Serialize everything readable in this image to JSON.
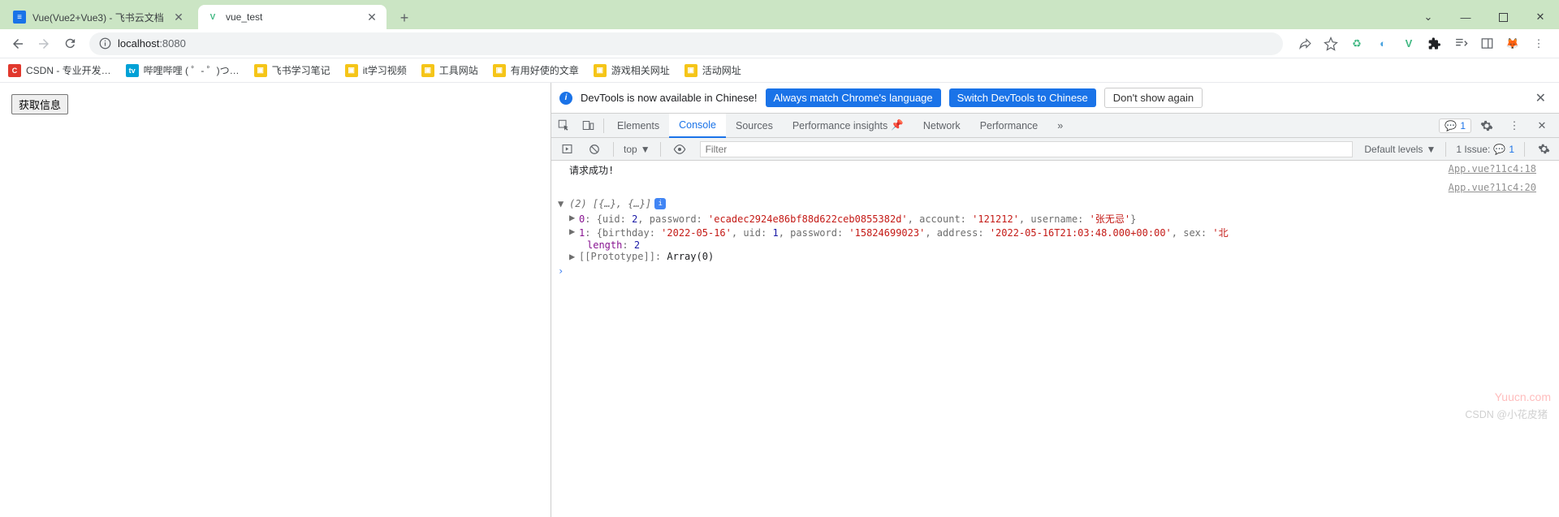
{
  "tabs": {
    "items": [
      {
        "title": "Vue(Vue2+Vue3) - 飞书云文档",
        "favicon_bg": "#1a73e8",
        "favicon_text": "≡",
        "active": false
      },
      {
        "title": "vue_test",
        "favicon_bg": "#fff",
        "favicon_text": "V",
        "active": true
      }
    ]
  },
  "address_bar": {
    "host": "localhost",
    "port": ":8080"
  },
  "bookmarks": [
    {
      "label": "CSDN - 专业开发…",
      "icon_bg": "#e1382d",
      "icon_text": "C"
    },
    {
      "label": "哔哩哔哩 ( ゜- ゜)つ…",
      "icon_bg": "#00a1d6",
      "icon_text": "b"
    },
    {
      "label": "飞书学习笔记",
      "folder": true
    },
    {
      "label": "it学习视频",
      "folder": true
    },
    {
      "label": "工具网站",
      "folder": true
    },
    {
      "label": "有用好使的文章",
      "folder": true
    },
    {
      "label": "游戏相关网址",
      "folder": true
    },
    {
      "label": "活动网址",
      "folder": true
    }
  ],
  "page": {
    "fetch_button": "获取信息"
  },
  "devtools": {
    "banner": {
      "text": "DevTools is now available in Chinese!",
      "btn_match": "Always match Chrome's language",
      "btn_switch": "Switch DevTools to Chinese",
      "btn_dismiss": "Don't show again"
    },
    "tabs": {
      "elements": "Elements",
      "console": "Console",
      "sources": "Sources",
      "perf_insights": "Performance insights",
      "network": "Network",
      "performance": "Performance",
      "badge_count": "1"
    },
    "filter": {
      "top": "top",
      "placeholder": "Filter",
      "levels": "Default levels",
      "issue_label": "1 Issue:",
      "issue_count": "1"
    },
    "console": {
      "line1_msg": "请求成功!",
      "line1_src": "App.vue?11c4:18",
      "line2_src": "App.vue?11c4:20",
      "arr_preview": "(2) [{…}, {…}]",
      "row0": {
        "idx": "0",
        "uid_k": "uid",
        "uid_v": "2",
        "pwd_k": "password",
        "pwd_v": "'ecadec2924e86bf88d622ceb0855382d'",
        "acc_k": "account",
        "acc_v": "'121212'",
        "usr_k": "username",
        "usr_v": "'张无忌'"
      },
      "row1": {
        "idx": "1",
        "bday_k": "birthday",
        "bday_v": "'2022-05-16'",
        "uid_k": "uid",
        "uid_v": "1",
        "pwd_k": "password",
        "pwd_v": "'15824699023'",
        "addr_k": "address",
        "addr_v": "'2022-05-16T21:03:48.000+00:00'",
        "sex_k": "sex",
        "sex_v": "'北"
      },
      "length_k": "length",
      "length_v": "2",
      "proto_k": "[[Prototype]]",
      "proto_v": "Array(0)"
    }
  },
  "watermark": {
    "site": "Yuucn.com",
    "author": "CSDN @小花皮猪"
  }
}
